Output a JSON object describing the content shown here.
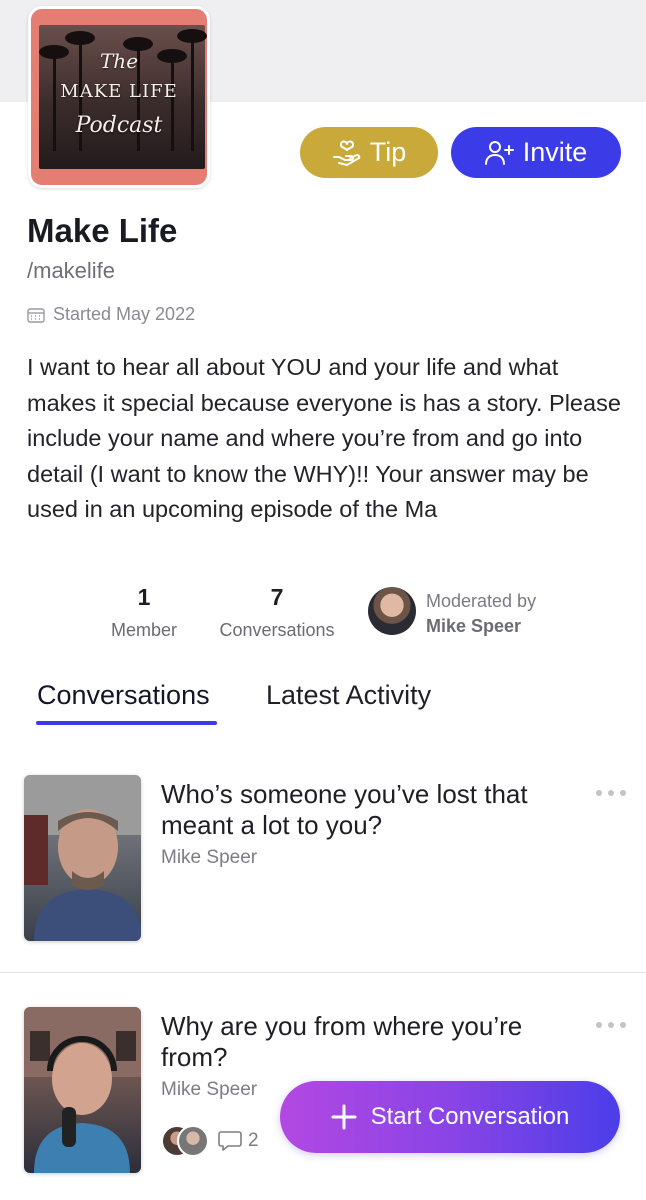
{
  "podcast": {
    "art_title_line1": "The",
    "art_title_line2": "MAKE LIFE",
    "art_title_line3": "Podcast",
    "name": "Make Life",
    "handle": "/makelife",
    "started": "Started May 2022",
    "description": "I want to hear all about YOU and your life and what makes it special because everyone is has a story. Please include your name and where you’re from and go into detail (I want to know the WHY)!!  Your answer may be used in an upcoming episode of the Ma"
  },
  "actions": {
    "tip_label": "Tip",
    "invite_label": "Invite"
  },
  "stats": {
    "members_count": "1",
    "members_label": "Member",
    "conversations_count": "7",
    "conversations_label": "Conversations",
    "moderated_by_label": "Moderated by",
    "moderator_name": "Mike Speer"
  },
  "tabs": {
    "active": "Conversations",
    "inactive": "Latest Activity"
  },
  "conversations": [
    {
      "question": "Who’s someone you’ve lost that meant a lot to you?",
      "author": "Mike Speer"
    },
    {
      "question": "Why are you from where you’re from?",
      "author": "Mike Speer",
      "reply_count": "2"
    }
  ],
  "fab": {
    "label": "Start Conversation"
  },
  "colors": {
    "accent": "#3b3ce7",
    "tip": "#c8a93a",
    "fab_start": "#b348e2",
    "fab_end": "#4b3ee8"
  }
}
